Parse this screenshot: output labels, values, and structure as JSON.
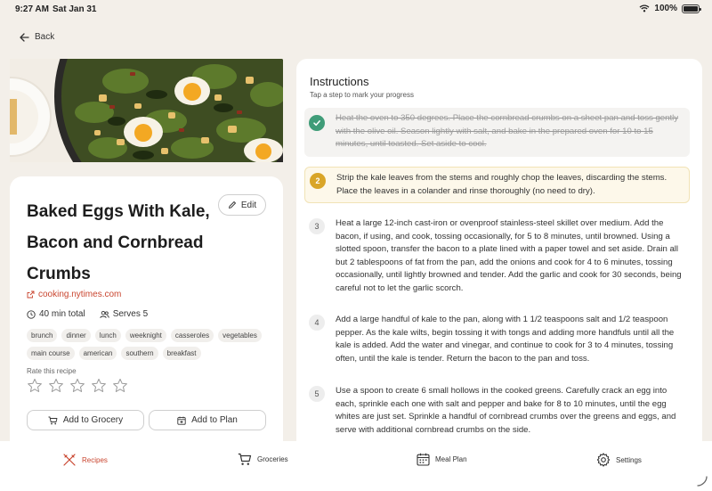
{
  "status": {
    "time": "9:27 AM",
    "date": "Sat Jan 31",
    "battery": "100%"
  },
  "nav": {
    "back_label": "Back"
  },
  "recipe": {
    "title": "Baked Eggs With Kale, Bacon and Cornbread Crumbs",
    "title_lines": [
      "Baked Eggs With Kale,",
      "Bacon and Cornbread",
      "Crumbs"
    ],
    "edit_label": "Edit",
    "source": "cooking.nytimes.com",
    "total_time": "40 min total",
    "serves": "Serves 5",
    "tags": [
      "brunch",
      "dinner",
      "lunch",
      "weeknight",
      "casseroles",
      "vegetables",
      "main course",
      "american",
      "southern",
      "breakfast"
    ],
    "rate_label": "Rate this recipe",
    "rating": 0,
    "rating_max": 5,
    "add_grocery_label": "Add to Grocery",
    "add_plan_label": "Add to Plan"
  },
  "instructions": {
    "title": "Instructions",
    "subtitle": "Tap a step to mark your progress",
    "steps": [
      {
        "number": "1",
        "state": "done",
        "text": "Heat the oven to 350 degrees. Place the cornbread crumbs on a sheet pan and toss gently with the olive oil. Season lightly with salt, and bake in the prepared oven for 10 to 15 minutes, until toasted. Set aside to cool."
      },
      {
        "number": "2",
        "state": "active",
        "text": "Strip the kale leaves from the stems and roughly chop the leaves, discarding the stems. Place the leaves in a colander and rinse thoroughly (no need to dry)."
      },
      {
        "number": "3",
        "state": "idle",
        "text": "Heat a large 12-inch cast-iron or ovenproof stainless-steel skillet over medium. Add the bacon, if using, and cook, tossing occasionally, for 5 to 8 minutes, until browned. Using a slotted spoon, transfer the bacon to a plate lined with a paper towel and set aside. Drain all but 2 tablespoons of fat from the pan, add the onions and cook for 4 to 6 minutes, tossing occasionally, until lightly browned and tender. Add the garlic and cook for 30 seconds, being careful not to let the garlic scorch."
      },
      {
        "number": "4",
        "state": "idle",
        "text": "Add a large handful of kale to the pan, along with 1 1/2 teaspoons salt and 1/2 teaspoon pepper. As the kale wilts, begin tossing it with tongs and adding more handfuls until all the kale is added. Add the water and vinegar, and continue to cook for 3 to 4 minutes, tossing often, until the kale is tender. Return the bacon to the pan and toss."
      },
      {
        "number": "5",
        "state": "idle",
        "text": "Use a spoon to create 6 small hollows in the cooked greens. Carefully crack an egg into each, sprinkle each one with salt and pepper and bake for 8 to 10 minutes, until the egg whites are just set. Sprinkle a handful of cornbread crumbs over the greens and eggs, and serve with additional cornbread crumbs on the side."
      }
    ]
  },
  "tabs": [
    {
      "label": "Recipes",
      "icon": "utensils-icon",
      "active": true
    },
    {
      "label": "Groceries",
      "icon": "cart-icon",
      "active": false
    },
    {
      "label": "Meal Plan",
      "icon": "calendar-icon",
      "active": false
    },
    {
      "label": "Settings",
      "icon": "gear-icon",
      "active": false
    }
  ],
  "colors": {
    "accent": "#c9452f",
    "done": "#3f9c78",
    "active": "#d9a528",
    "background": "#f3efe9"
  }
}
